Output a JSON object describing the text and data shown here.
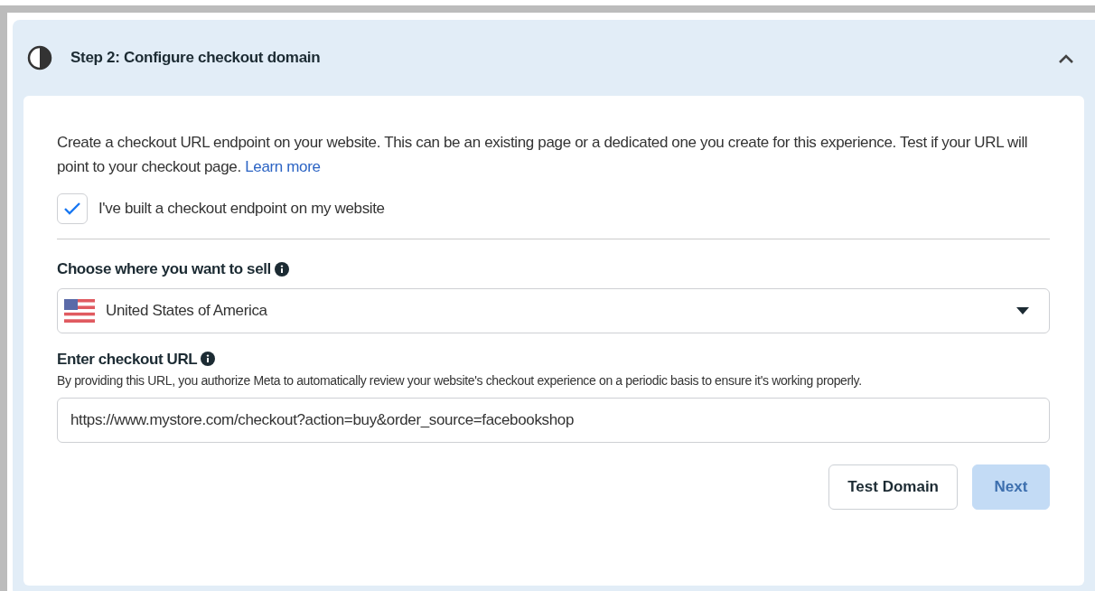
{
  "step": {
    "title": "Step 2: Configure checkout domain",
    "expanded": true
  },
  "intro": {
    "text": "Create a checkout URL endpoint on your website. This can be an existing page or a dedicated one you create for this experience. Test if your URL will point to your checkout page.",
    "link": "Learn more"
  },
  "confirm": {
    "label": "I've built a checkout endpoint on my website",
    "checked": true
  },
  "country": {
    "label": "Choose where you want to sell",
    "value": "United States of America"
  },
  "url": {
    "label": "Enter checkout URL",
    "help": "By providing this URL, you authorize Meta to automatically review your website's checkout experience on a periodic basis to ensure it's working properly.",
    "value": "https://www.mystore.com/checkout?action=buy&order_source=facebookshop"
  },
  "buttons": [
    {
      "label": "Test Domain",
      "kind": "secondary",
      "disabled": false
    },
    {
      "label": "Next",
      "kind": "primary",
      "disabled": true
    }
  ]
}
